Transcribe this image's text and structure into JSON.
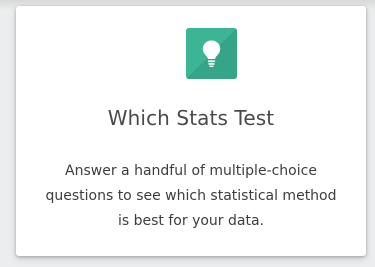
{
  "card": {
    "icon": "lightbulb-icon",
    "icon_color": "#3cb594",
    "title": "Which Stats Test",
    "description_lines": [
      "Answer a handful of multiple-choice",
      "questions to see which statistical method",
      "is best for your data."
    ]
  }
}
